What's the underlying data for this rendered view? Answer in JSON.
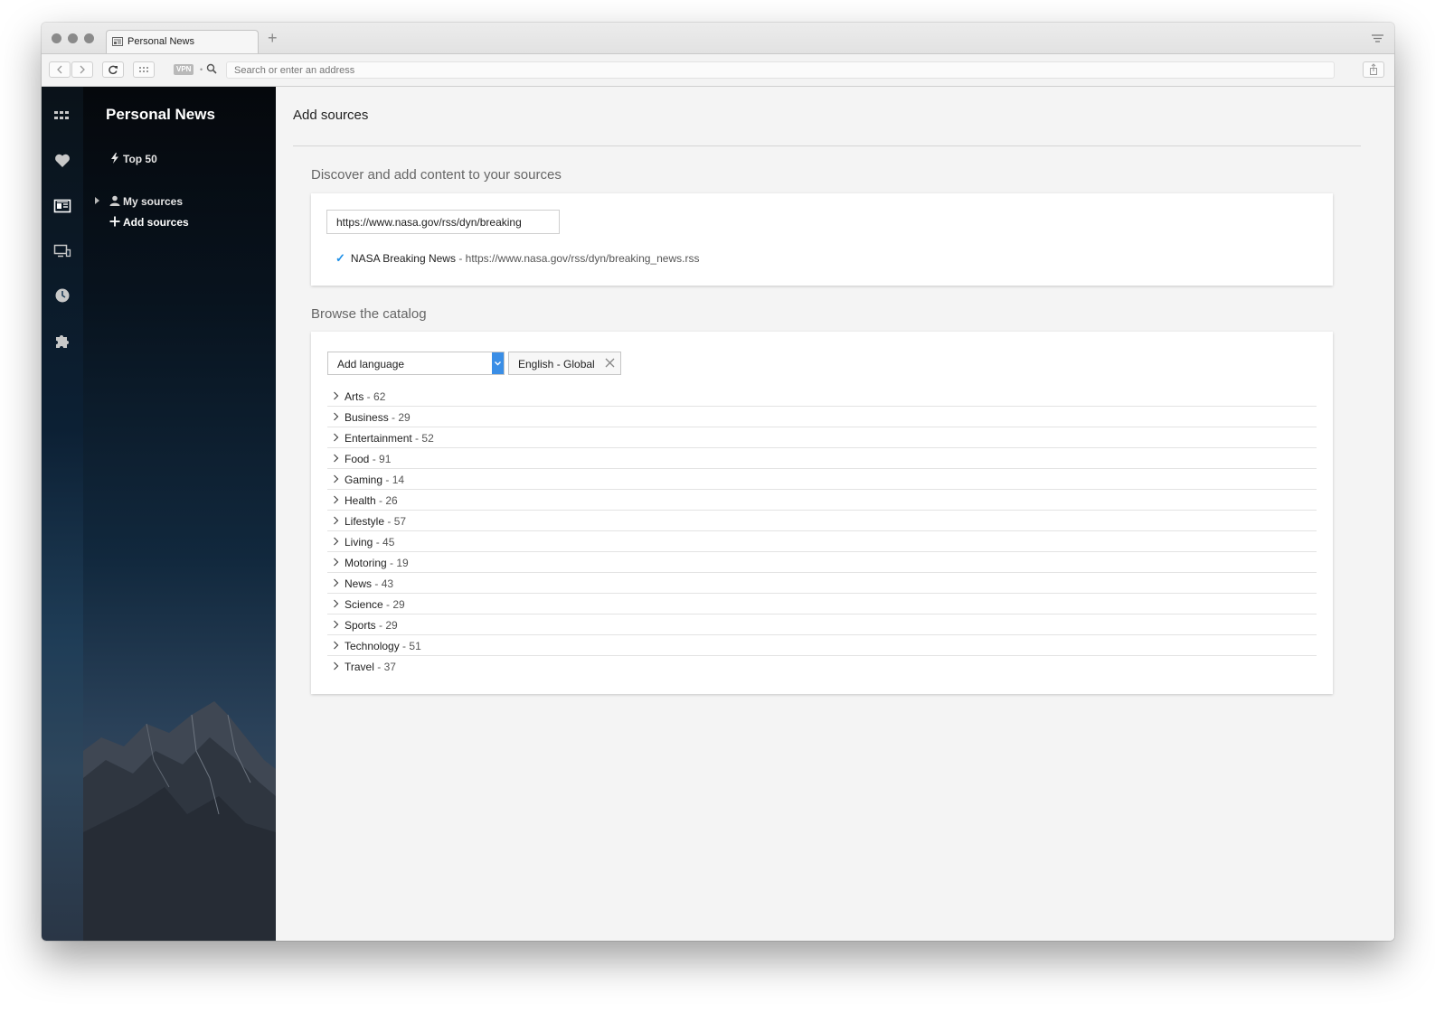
{
  "tab": {
    "title": "Personal News"
  },
  "address": {
    "placeholder": "Search or enter an address",
    "vpn_label": "VPN"
  },
  "panel": {
    "title": "Personal News",
    "top50": "Top 50",
    "my_sources": "My sources",
    "add_sources": "Add sources"
  },
  "main": {
    "title": "Add sources",
    "discover_heading": "Discover and add content to your sources",
    "url_value": "https://www.nasa.gov/rss/dyn/breaking",
    "result": {
      "name": "NASA Breaking News",
      "separator": "-",
      "url": "https://www.nasa.gov/rss/dyn/breaking_news.rss"
    },
    "catalog_heading": "Browse the catalog",
    "language_select": "Add language",
    "language_chip": "English - Global",
    "categories": [
      {
        "name": "Arts",
        "count": "62"
      },
      {
        "name": "Business",
        "count": "29"
      },
      {
        "name": "Entertainment",
        "count": "52"
      },
      {
        "name": "Food",
        "count": "91"
      },
      {
        "name": "Gaming",
        "count": "14"
      },
      {
        "name": "Health",
        "count": "26"
      },
      {
        "name": "Lifestyle",
        "count": "57"
      },
      {
        "name": "Living",
        "count": "45"
      },
      {
        "name": "Motoring",
        "count": "19"
      },
      {
        "name": "News",
        "count": "43"
      },
      {
        "name": "Science",
        "count": "29"
      },
      {
        "name": "Sports",
        "count": "29"
      },
      {
        "name": "Technology",
        "count": "51"
      },
      {
        "name": "Travel",
        "count": "37"
      }
    ]
  },
  "colors": {
    "accent": "#3a8ee6",
    "check": "#1e90e8",
    "panel_dark": "#05080c"
  }
}
